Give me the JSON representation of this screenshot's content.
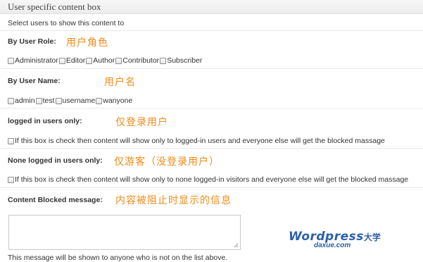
{
  "box_title": "User specific content box",
  "intro": "Select users to show this content to",
  "role": {
    "label": "By User Role:",
    "note": "用户角色",
    "options": [
      "Administrator",
      "Editor",
      "Author",
      "Contributor",
      "Subscriber"
    ]
  },
  "username": {
    "label": "By User Name:",
    "note": "用户名",
    "options": [
      "admin",
      "test",
      "username",
      "wanyone"
    ]
  },
  "logged_in": {
    "label": "logged in users only:",
    "note": "仅登录用户",
    "checkbox_text": "If this box is check then content will show only to logged-in users and everyone else will get the blocked massage"
  },
  "none_logged": {
    "label": "None logged in users only:",
    "note": "仅游客（没登录用户）",
    "checkbox_text": "If this box is check then content will show only to none logged-in visitors and everyone else will get the blocked massage"
  },
  "blocked": {
    "label": "Content Blocked message:",
    "note": "内容被阻止时显示的信息",
    "textarea_value": "",
    "help": "This message will be shown to anyone who is not on the list above."
  },
  "watermark": {
    "word": "Wordpress",
    "cn": "大学",
    "domain": "daxue.com"
  },
  "colors": {
    "note": "#f08a18",
    "logo": "#2c5fa8"
  }
}
